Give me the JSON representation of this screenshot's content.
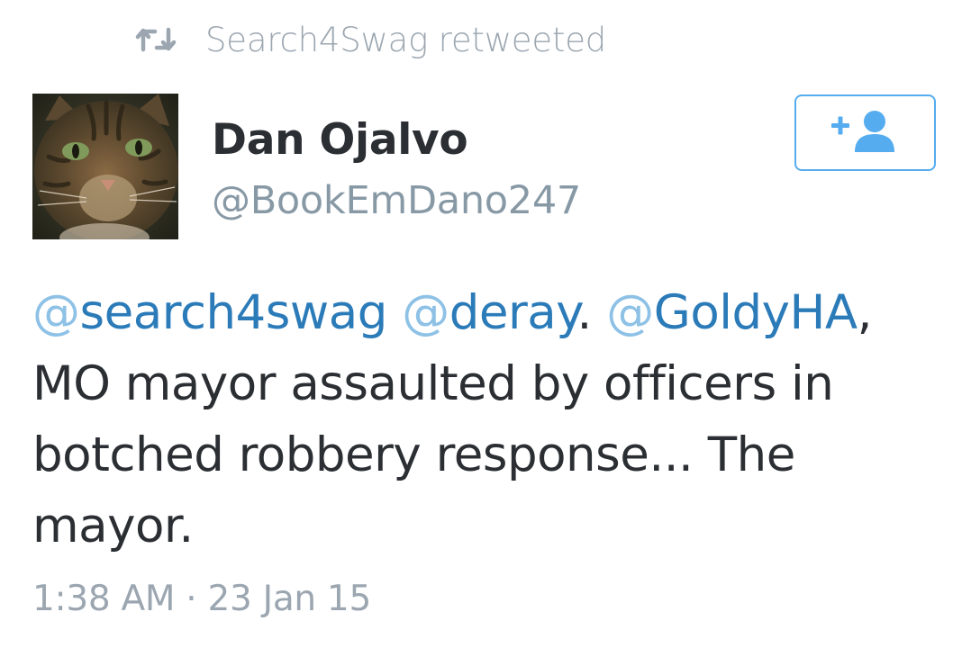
{
  "retweet_context": {
    "icon": "retweet-icon",
    "text": "Search4Swag retweeted"
  },
  "author": {
    "avatar_icon": "cat-avatar",
    "display_name": "Dan Ojalvo",
    "handle": "@BookEmDano247"
  },
  "follow_button": {
    "icon": "follow-user-icon",
    "plus": "+"
  },
  "tweet": {
    "mentions": [
      {
        "at": "@",
        "name": "search4swag"
      },
      {
        "at": "@",
        "name": "deray"
      },
      {
        "at": "@",
        "name": "GoldyHA"
      }
    ],
    "sep_space": " ",
    "sep_dot": ". ",
    "sep_comma": ",",
    "line2": "MO mayor assaulted by officers in",
    "line3": "botched robbery response... The",
    "line4": "mayor."
  },
  "timestamp": "1:38 AM · 23 Jan 15",
  "colors": {
    "link": "#2b7bb9",
    "link_at": "#8ec1e6",
    "text": "#2b2f33",
    "muted": "#9ba6b0",
    "button_border": "#55acee"
  }
}
